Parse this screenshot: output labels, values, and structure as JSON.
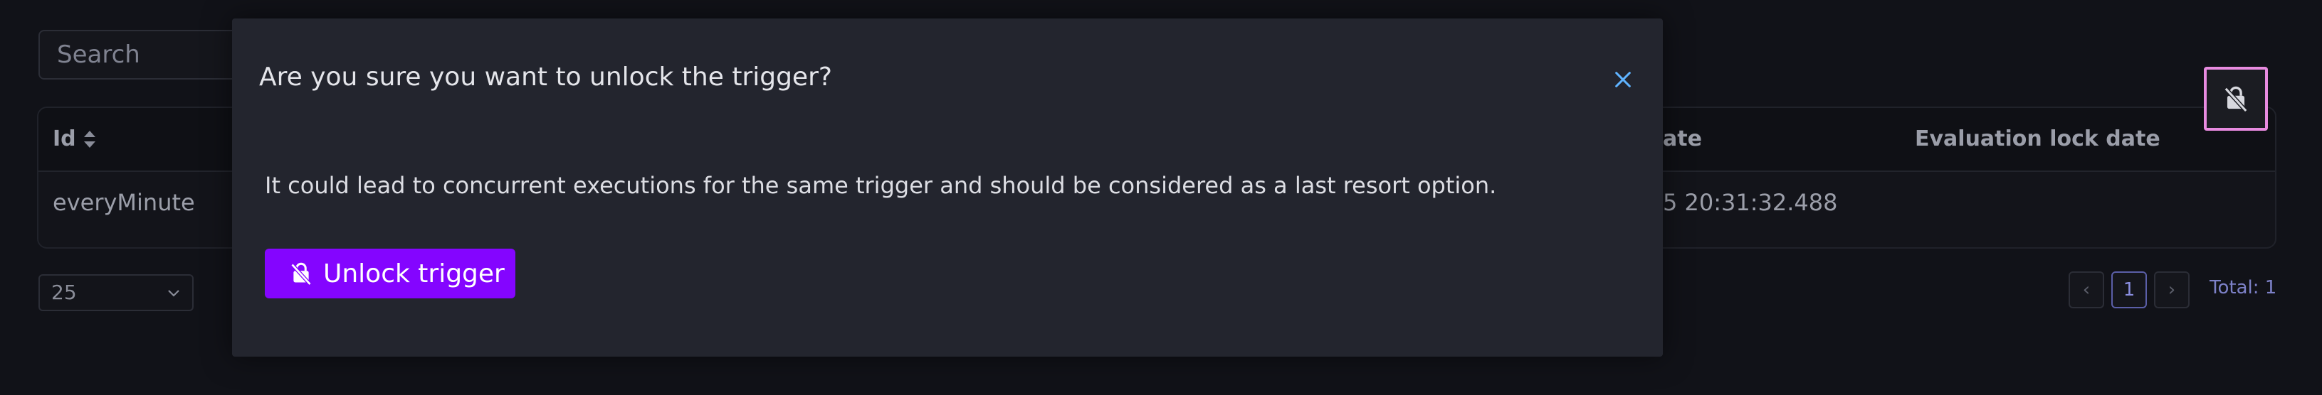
{
  "search": {
    "placeholder": "Search"
  },
  "table": {
    "columns": {
      "id": "Id",
      "date": "ate",
      "evaluation_lock_date": "Evaluation lock date"
    },
    "rows": [
      {
        "id": "everyMinute",
        "date": "5 20:31:32.488",
        "evaluation_lock_date": ""
      }
    ]
  },
  "pagination": {
    "per_page": "25",
    "prev": "‹",
    "current_page": "1",
    "next": "›",
    "total": "Total: 1"
  },
  "modal": {
    "title": "Are you sure you want to unlock the trigger?",
    "message": "It could lead to concurrent executions for the same trigger and should be considered as a last resort option.",
    "confirm_label": "Unlock trigger"
  },
  "colors": {
    "accent": "#8405ff",
    "highlight": "#e88be0",
    "close_icon": "#5fb3ff"
  },
  "icons": {
    "sort": "sort-icon",
    "lock_off": "lock-off-icon",
    "close": "close-icon",
    "chevron": "chevron-down-icon"
  }
}
